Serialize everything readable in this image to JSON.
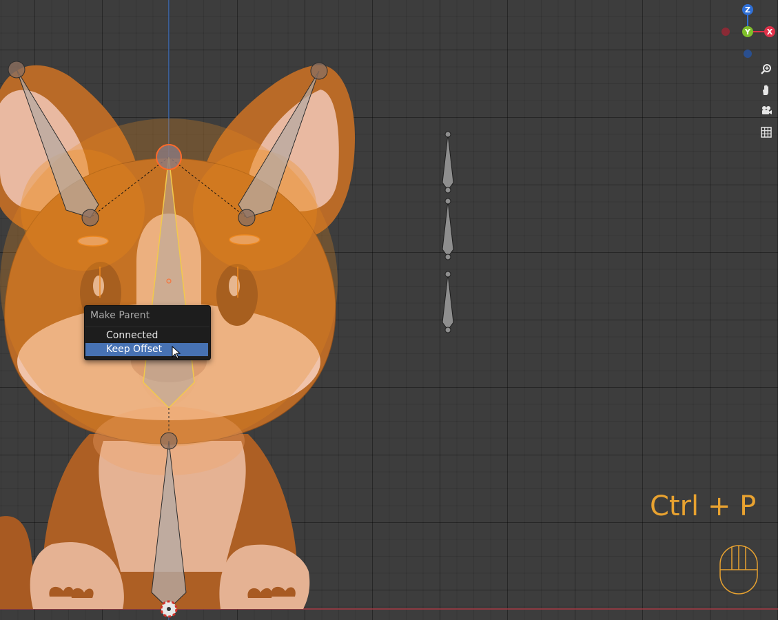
{
  "context_menu": {
    "title": "Make Parent",
    "items": [
      {
        "label": "Connected",
        "active": false
      },
      {
        "label": "Keep Offset",
        "active": true
      }
    ]
  },
  "shortcut_overlay": {
    "text": "Ctrl + P",
    "mouse_icon": "mouse-icon"
  },
  "gizmo": {
    "axes": [
      {
        "label": "Z",
        "color": "#2f6fd6"
      },
      {
        "label": "Y",
        "color": "#7fbf2a"
      },
      {
        "label": "X",
        "color": "#e0324a"
      }
    ]
  },
  "nav_buttons": [
    "zoom-icon",
    "pan-hand-icon",
    "camera-icon",
    "grid-icon"
  ],
  "colors": {
    "viewport_bg": "#3d3d3d",
    "menu_bg": "#1d1d1d",
    "menu_highlight": "#4772b3",
    "shortcut_text": "#e8a230",
    "bone_selected": "#f2c94c",
    "bone_active_edge": "#ff6a2a",
    "fur_orange": "#b96a27",
    "fur_light": "#e5b293"
  }
}
